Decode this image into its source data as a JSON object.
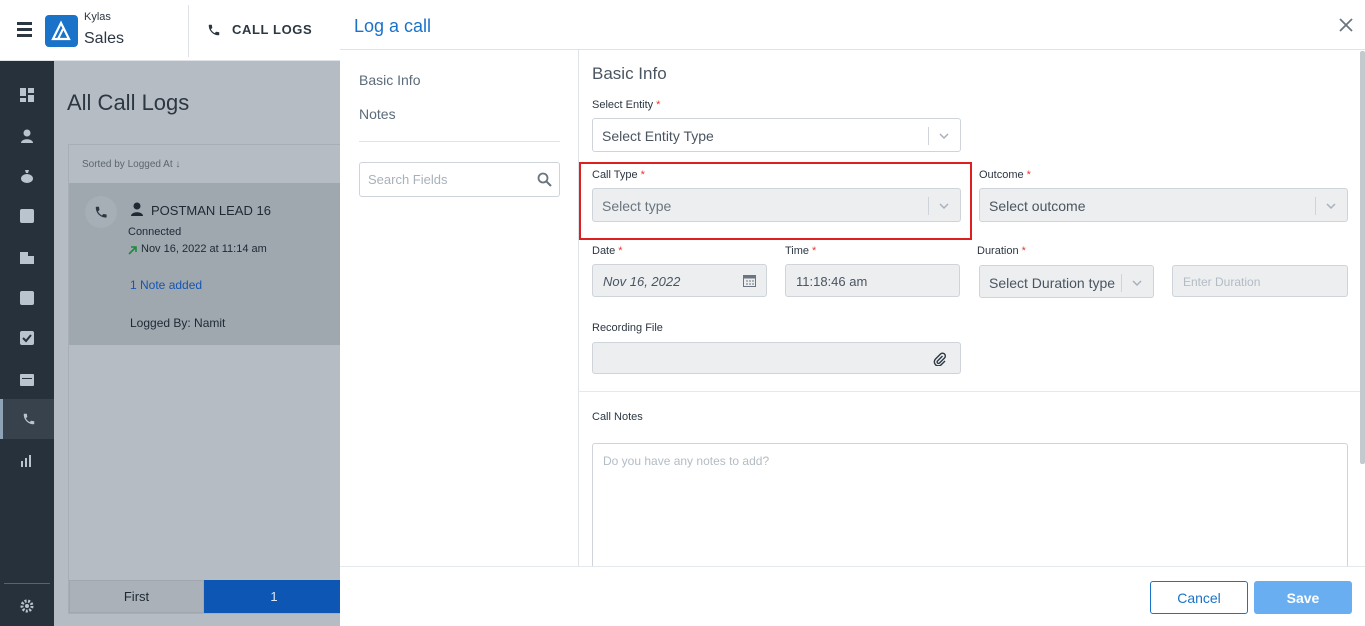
{
  "app": {
    "brand_top": "Kylas",
    "brand_main": "Sales",
    "module": "CALL LOGS"
  },
  "sidebar": {
    "items": [
      "dashboard-icon",
      "contacts-icon",
      "deals-icon",
      "leads-icon",
      "companies-icon",
      "products-icon",
      "tasks-icon",
      "calendar-icon",
      "calls-icon",
      "reports-icon",
      "settings-icon"
    ],
    "active": "calls-icon"
  },
  "background": {
    "title": "All Call Logs",
    "sorted_by": "Sorted by Logged At ↓",
    "call": {
      "lead": "POSTMAN LEAD 16",
      "status": "Connected",
      "date": "Nov 16, 2022 at 11:14 am",
      "note": "1 Note added",
      "logged_by": "Logged By: Namit"
    },
    "pager": {
      "first": "First",
      "current": "1"
    }
  },
  "modal": {
    "title": "Log a call",
    "nav": [
      "Basic Info",
      "Notes"
    ],
    "search_placeholder": "Search Fields",
    "section_title": "Basic Info",
    "fields": {
      "entity": {
        "label": "Select Entity",
        "value": "Select Entity Type"
      },
      "call_type": {
        "label": "Call Type",
        "value": "Select type"
      },
      "outcome": {
        "label": "Outcome",
        "value": "Select outcome"
      },
      "date": {
        "label": "Date",
        "value": "Nov 16, 2022"
      },
      "time": {
        "label": "Time",
        "value": "11:18:46 am"
      },
      "duration": {
        "label": "Duration",
        "value": "Select Duration type",
        "placeholder": "Enter Duration"
      },
      "recording": {
        "label": "Recording File"
      },
      "notes": {
        "label": "Call Notes",
        "placeholder": "Do you have any notes to add?"
      }
    },
    "required_mark": "*",
    "buttons": {
      "cancel": "Cancel",
      "save": "Save"
    }
  },
  "colors": {
    "primary": "#1a73c9",
    "highlight": "#dd1f1f",
    "save_disabled": "#6aaef2"
  }
}
